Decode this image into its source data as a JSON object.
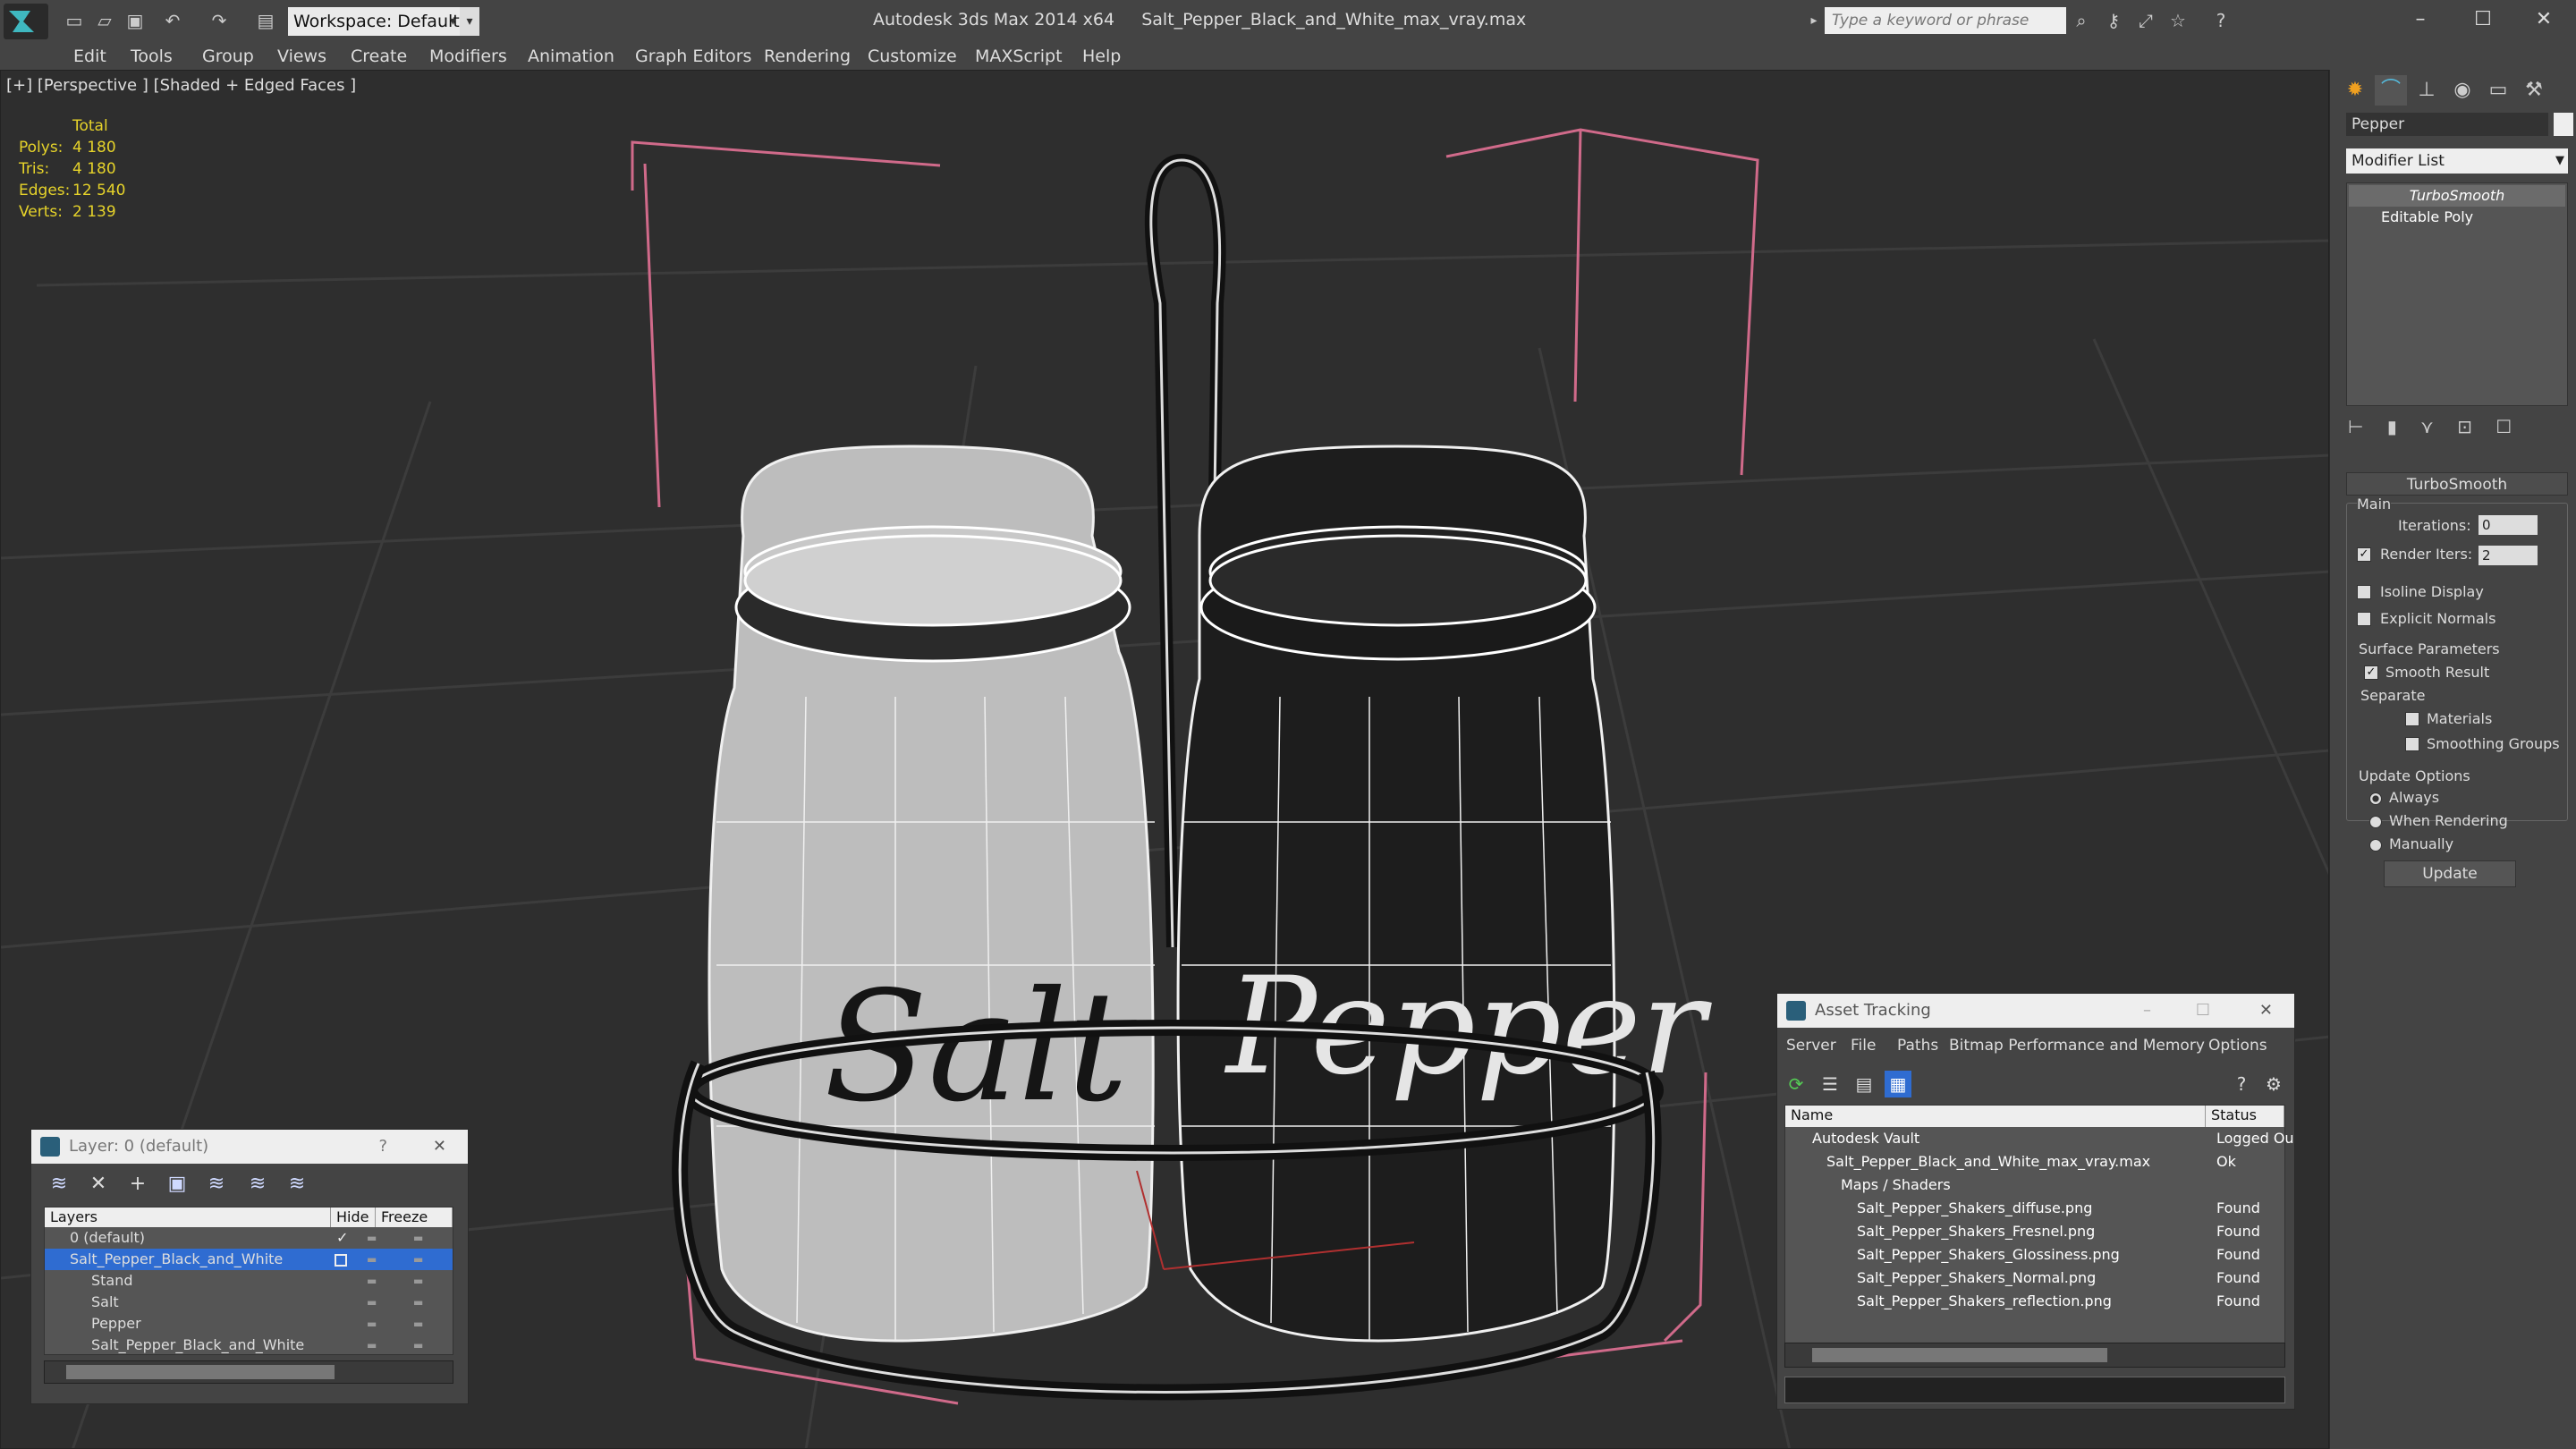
{
  "app": {
    "title": "Autodesk 3ds Max 2014 x64     Salt_Pepper_Black_and_White_max_vray.max",
    "workspace": "Workspace: Default",
    "search_placeholder": "Type a keyword or phrase"
  },
  "window_controls": {
    "minimize": "–",
    "maximize": "☐",
    "close": "✕"
  },
  "menu": [
    "Edit",
    "Tools",
    "Group",
    "Views",
    "Create",
    "Modifiers",
    "Animation",
    "Graph Editors",
    "Rendering",
    "Customize",
    "MAXScript",
    "Help"
  ],
  "viewport": {
    "label": "[+] [Perspective ] [Shaded + Edged Faces ]",
    "stats": {
      "header": "Total",
      "rows": [
        {
          "k": "Polys:",
          "v": "4 180"
        },
        {
          "k": "Tris:",
          "v": "4 180"
        },
        {
          "k": "Edges:",
          "v": "12 540"
        },
        {
          "k": "Verts:",
          "v": "2 139"
        }
      ]
    },
    "salt_text": "Salt",
    "pepper_text": "Pepper"
  },
  "command_panel": {
    "object_name": "Pepper",
    "modifier_list": "Modifier List",
    "stack": [
      "TurboSmooth",
      "Editable Poly"
    ],
    "rollout": "TurboSmooth",
    "main_label": "Main",
    "iterations_label": "Iterations:",
    "iterations_value": "0",
    "render_iters_label": "Render Iters:",
    "render_iters_value": "2",
    "render_iters_checked": true,
    "isoline_display": "Isoline Display",
    "explicit_normals": "Explicit Normals",
    "surface_parameters": "Surface Parameters",
    "smooth_result": "Smooth Result",
    "separate": "Separate",
    "materials": "Materials",
    "smoothing_groups": "Smoothing Groups",
    "update_options": "Update Options",
    "always": "Always",
    "when_rendering": "When Rendering",
    "manually": "Manually",
    "update_button": "Update"
  },
  "layer_window": {
    "title": "Layer: 0 (default)",
    "help": "?",
    "close": "✕",
    "columns": [
      "Layers",
      "Hide",
      "Freeze"
    ],
    "rows": [
      {
        "name": "0 (default)",
        "indent": 0
      },
      {
        "name": "Salt_Pepper_Black_and_White",
        "indent": 0,
        "selected": true
      },
      {
        "name": "Stand",
        "indent": 1
      },
      {
        "name": "Salt",
        "indent": 1
      },
      {
        "name": "Pepper",
        "indent": 1
      },
      {
        "name": "Salt_Pepper_Black_and_White",
        "indent": 1
      }
    ]
  },
  "asset_window": {
    "title": "Asset Tracking",
    "menu": [
      "Server",
      "File",
      "Paths",
      "Bitmap Performance and Memory",
      "Options"
    ],
    "columns": [
      "Name",
      "Status"
    ],
    "rows": [
      {
        "name": "Autodesk Vault",
        "status": "Logged Ou",
        "indent": 0
      },
      {
        "name": "Salt_Pepper_Black_and_White_max_vray.max",
        "status": "Ok",
        "indent": 1
      },
      {
        "name": "Maps / Shaders",
        "status": "",
        "indent": 2
      },
      {
        "name": "Salt_Pepper_Shakers_diffuse.png",
        "status": "Found",
        "indent": 3
      },
      {
        "name": "Salt_Pepper_Shakers_Fresnel.png",
        "status": "Found",
        "indent": 3
      },
      {
        "name": "Salt_Pepper_Shakers_Glossiness.png",
        "status": "Found",
        "indent": 3
      },
      {
        "name": "Salt_Pepper_Shakers_Normal.png",
        "status": "Found",
        "indent": 3
      },
      {
        "name": "Salt_Pepper_Shakers_reflection.png",
        "status": "Found",
        "indent": 3
      }
    ]
  }
}
